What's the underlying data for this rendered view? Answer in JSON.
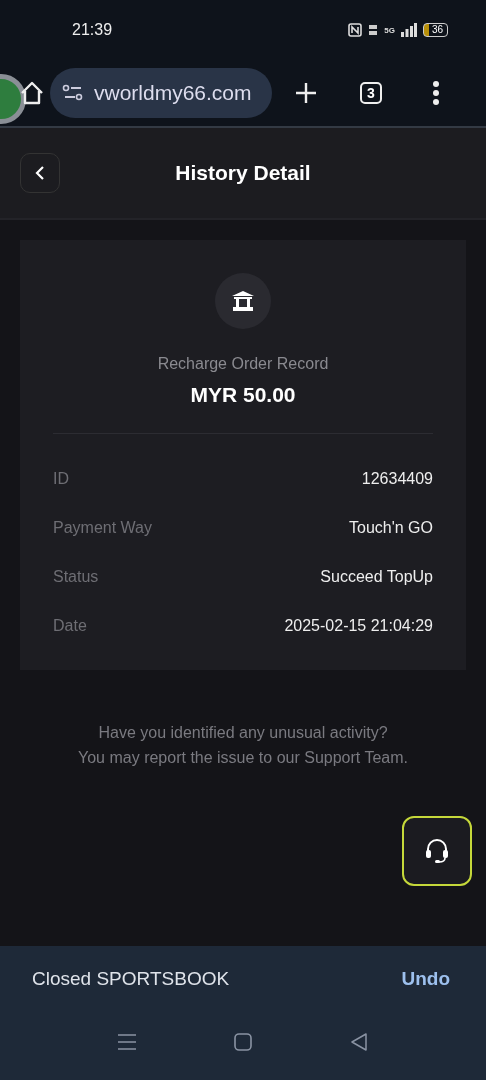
{
  "status_bar": {
    "time": "21:39",
    "network": "5G",
    "battery": "36"
  },
  "browser": {
    "url": "vworldmy66.com",
    "tab_count": "3"
  },
  "header": {
    "title": "History Detail"
  },
  "record": {
    "type": "Recharge Order Record",
    "amount": "MYR 50.00",
    "rows": [
      {
        "label": "ID",
        "value": "12634409"
      },
      {
        "label": "Payment Way",
        "value": "Touch'n GO"
      },
      {
        "label": "Status",
        "value": "Succeed TopUp"
      },
      {
        "label": "Date",
        "value": "2025-02-15 21:04:29"
      }
    ]
  },
  "notice": [
    "Have you identified any unusual activity?",
    "You may report the issue to our Support Team."
  ],
  "snackbar": {
    "message": "Closed SPORTSBOOK",
    "action": "Undo"
  }
}
